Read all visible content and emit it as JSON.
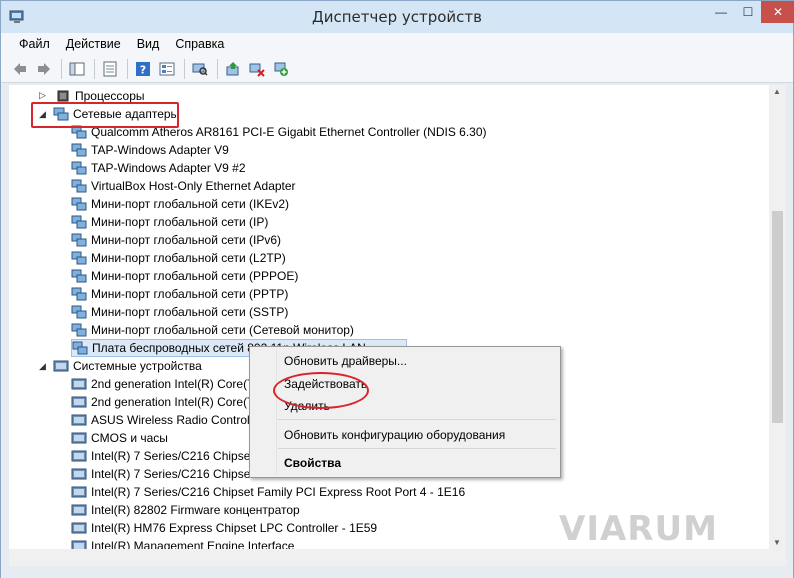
{
  "window": {
    "title": "Диспетчер устройств",
    "minimize_glyph": "—",
    "maximize_glyph": "☐",
    "close_glyph": "✕"
  },
  "menu": [
    "Файл",
    "Действие",
    "Вид",
    "Справка"
  ],
  "toolbar_icons": [
    "back-icon",
    "forward-icon",
    "show-hide-console-tree-icon",
    "properties-icon",
    "help-icon",
    "view-icon",
    "scan-hardware-icon",
    "update-driver-icon",
    "uninstall-icon",
    "enable-device-icon"
  ],
  "tree": {
    "processors": {
      "label": "Процессоры",
      "expander": "▷"
    },
    "network_adapters": {
      "label": "Сетевые адаптеры",
      "expander": "◢",
      "items": [
        "Qualcomm Atheros AR8161 PCI-E Gigabit Ethernet Controller (NDIS 6.30)",
        "TAP-Windows Adapter V9",
        "TAP-Windows Adapter V9 #2",
        "VirtualBox Host-Only Ethernet Adapter",
        "Мини-порт глобальной сети (IKEv2)",
        "Мини-порт глобальной сети (IP)",
        "Мини-порт глобальной сети (IPv6)",
        "Мини-порт глобальной сети (L2TP)",
        "Мини-порт глобальной сети (PPPOE)",
        "Мини-порт глобальной сети (PPTP)",
        "Мини-порт глобальной сети (SSTP)",
        "Мини-порт глобальной сети (Сетевой монитор)",
        "Плата беспроводных сетей 802.11n Wireless LAN"
      ]
    },
    "system_devices": {
      "label": "Системные устройства",
      "expander": "◢",
      "items": [
        "2nd generation Intel(R) Core(T",
        "2nd generation Intel(R) Core(T",
        "ASUS Wireless Radio Control",
        "CMOS и часы",
        "Intel(R) 7 Series/C216 Chipset",
        "Intel(R) 7 Series/C216 Chipset",
        "Intel(R) 7 Series/C216 Chipset Family PCI Express Root Port 4 - 1E16",
        "Intel(R) 82802 Firmware концентратор",
        "Intel(R) HM76 Express Chipset LPC Controller - 1E59",
        "Intel(R) Management Engine Interface"
      ]
    }
  },
  "context_menu": {
    "update_drivers": "Обновить драйверы...",
    "enable": "Задействовать",
    "uninstall": "Удалить",
    "scan_hardware": "Обновить конфигурацию оборудования",
    "properties": "Свойства"
  },
  "watermark": "VIARUM",
  "scrollbar": {
    "up_arrow": "▲",
    "down_arrow": "▼"
  },
  "colors": {
    "highlight": "#d6262b",
    "selection": "#dbe8f6"
  }
}
